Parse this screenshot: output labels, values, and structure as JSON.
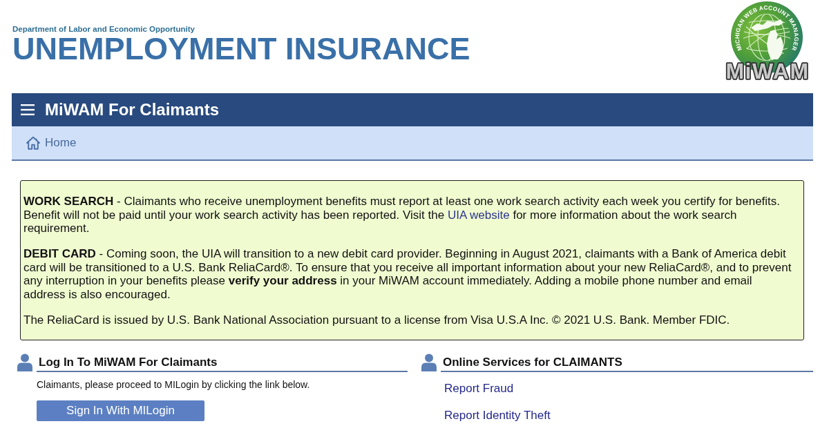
{
  "header": {
    "department": "Department of Labor and Economic Opportunity",
    "title": "UNEMPLOYMENT INSURANCE",
    "logo": {
      "arc_text": "MICHIGAN WEB ACCOUNT MANAGER",
      "wordmark": "MiWAM"
    }
  },
  "nav_bar": {
    "title": "MiWAM For Claimants"
  },
  "breadcrumb": {
    "label": "Home"
  },
  "notice": {
    "paragraphs": [
      {
        "text": "**WORK SEARCH** - Claimants who receive unemployment benefits must report at least one work search activity each week you certify for benefits. Benefit will not be paid until your work search activity has been reported. Visit the",
        "link": "UIA website",
        "text_after": "for more information about the work search requirement."
      },
      {
        "text": "**DEBIT CARD** - Coming soon, the UIA will transition to a new debit card provider. Beginning in August 2021, claimants with a Bank of America debit card will be transitioned to a U.S. Bank ReliaCard®. To ensure that you receive all important information about your new ReliaCard®, and to prevent any interruption in your benefits please **verify your address** in your MiWAM account immediately. Adding a mobile phone number and email address is also encouraged."
      },
      {
        "text": "The ReliaCard is issued by U.S. Bank National Association pursuant to a license from Visa U.S.A Inc. © 2021 U.S. Bank. Member FDIC."
      }
    ]
  },
  "login_section": {
    "title": "Log In To MiWAM For Claimants",
    "description": "Claimants, please proceed to MILogin by clicking the link below.",
    "button": "Sign In With MILogin"
  },
  "services_section": {
    "title": "Online Services for CLAIMANTS",
    "links": [
      "Report Fraud",
      "Report Identity Theft"
    ]
  }
}
